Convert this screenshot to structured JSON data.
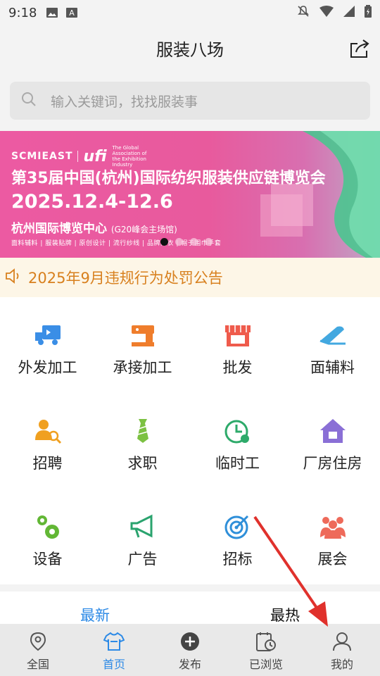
{
  "status_bar": {
    "time": "9:18"
  },
  "header": {
    "title": "服装八场"
  },
  "search": {
    "placeholder": "输入关键词，找找服装事"
  },
  "banner": {
    "logo_text": "SCMIEAST",
    "ufi": "ufi",
    "ufi_sub": "The Global Association of the Exhibition Industry",
    "title": "第35届中国(杭州)国际纺织服装供应链博览会",
    "date": "2025.12.4-12.6",
    "venue": "杭州国际博览中心",
    "venue_note": "(G20峰会主场馆)",
    "tags": "面料辅料 | 服装贴牌 | 原创设计 | 流行纱线 | 品牌内衣 | 帽子围巾手套",
    "active_dot": 0
  },
  "notice": {
    "text": "2025年9月违规行为处罚公告"
  },
  "grid": [
    {
      "label": "外发加工",
      "icon": "truck-icon",
      "color": "#3a8ee6"
    },
    {
      "label": "承接加工",
      "icon": "sewing-machine-icon",
      "color": "#ef7d2c"
    },
    {
      "label": "批发",
      "icon": "shop-icon",
      "color": "#ef5b4c"
    },
    {
      "label": "面辅料",
      "icon": "fabric-roll-icon",
      "color": "#43a8e0"
    },
    {
      "label": "招聘",
      "icon": "recruit-icon",
      "color": "#f0a020"
    },
    {
      "label": "求职",
      "icon": "tie-icon",
      "color": "#7cc142"
    },
    {
      "label": "临时工",
      "icon": "clock-icon",
      "color": "#2daa6a"
    },
    {
      "label": "厂房住房",
      "icon": "house-icon",
      "color": "#8a6fd6"
    },
    {
      "label": "设备",
      "icon": "gears-icon",
      "color": "#62b735"
    },
    {
      "label": "广告",
      "icon": "megaphone-icon",
      "color": "#2aa36e"
    },
    {
      "label": "招标",
      "icon": "target-icon",
      "color": "#2f8fd9"
    },
    {
      "label": "展会",
      "icon": "people-icon",
      "color": "#ee6a5a"
    }
  ],
  "tabs": [
    {
      "label": "最新",
      "active": true
    },
    {
      "label": "最热",
      "active": false
    }
  ],
  "bottom_nav": [
    {
      "label": "全国",
      "icon": "location-pin-icon"
    },
    {
      "label": "首页",
      "icon": "tshirt-icon",
      "active": true
    },
    {
      "label": "发布",
      "icon": "plus-circle-icon"
    },
    {
      "label": "已浏览",
      "icon": "history-icon"
    },
    {
      "label": "我的",
      "icon": "user-icon"
    }
  ]
}
